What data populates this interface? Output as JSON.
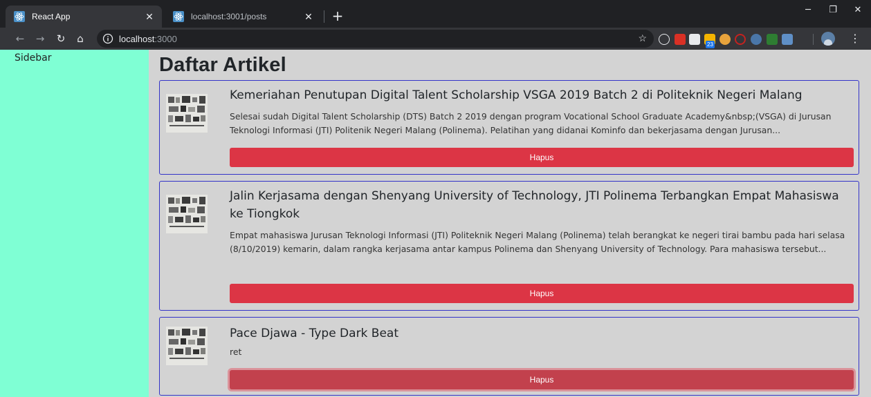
{
  "browser": {
    "tabs": [
      {
        "title": "React App",
        "active": true
      },
      {
        "title": "localhost:3001/posts",
        "active": false
      }
    ],
    "address": {
      "host": "localhost",
      "port": ":3000"
    },
    "extension_badge": "23"
  },
  "sidebar": {
    "label": "Sidebar",
    "bg_color": "#7fffd4"
  },
  "main": {
    "heading": "Daftar Artikel",
    "delete_color": "#dc3545",
    "card_border_color": "#3232c8",
    "articles": [
      {
        "title": "Kemeriahan Penutupan Digital Talent Scholarship VSGA 2019 Batch 2 di Politeknik Negeri Malang",
        "excerpt": "Selesai sudah Digital Talent Scholarship (DTS) Batch 2 2019 dengan program Vocational School Graduate Academy&nbsp;(VSGA) di Jurusan Teknologi Informasi (JTI) Politenik Negeri Malang (Polinema). Pelatihan yang didanai Kominfo dan bekerjasama dengan Jurusan...",
        "button": "Hapus"
      },
      {
        "title": "Jalin Kerjasama dengan Shenyang University of Technology, JTI Polinema Terbangkan Empat Mahasiswa ke Tiongkok",
        "excerpt": "Empat mahasiswa Jurusan Teknologi Informasi (JTI) Politeknik Negeri Malang (Polinema) telah berangkat ke negeri tirai bambu pada hari selasa (8/10/2019) kemarin, dalam rangka kerjasama antar kampus Polinema dan Shenyang University of Technology. Para mahasiswa tersebut...",
        "button": "Hapus"
      },
      {
        "title": "Pace Djawa - Type Dark Beat",
        "excerpt": "ret",
        "button": "Hapus"
      }
    ]
  }
}
